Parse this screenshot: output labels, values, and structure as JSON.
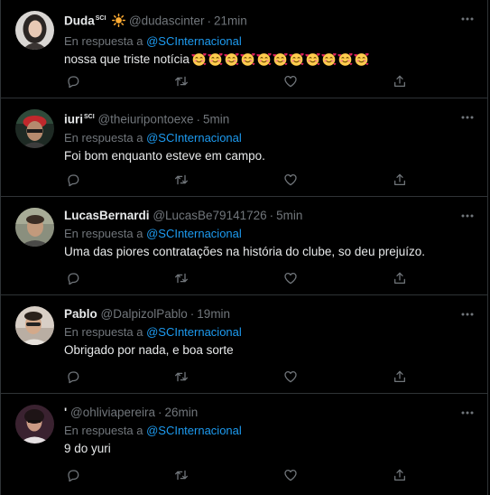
{
  "colors": {
    "background": "#000000",
    "text": "#e7e9ea",
    "muted": "#71767b",
    "link": "#1d9bf0",
    "divider": "#2f3336"
  },
  "reply_prefix": "En respuesta a",
  "tweets": [
    {
      "name": "Duda",
      "name_suffix": "SCI",
      "name_icon": "sun-icon",
      "handle": "@dudascinter",
      "dot": "·",
      "time": "21min",
      "mention": "@SCInternacional",
      "text": "nossa que triste notícia",
      "trailing_emoji": "smiling-face-with-hearts-icon",
      "trailing_emoji_count": 11
    },
    {
      "name": "iuri",
      "name_suffix": "SCI",
      "handle": "@theiuripontoexe",
      "dot": "·",
      "time": "5min",
      "mention": "@SCInternacional",
      "text": "Foi bom enquanto esteve em campo."
    },
    {
      "name": "LucasBernardi",
      "handle": "@LucasBe79141726",
      "dot": "·",
      "time": "5min",
      "mention": "@SCInternacional",
      "text": "Uma das piores contratações na história do clube, so deu prejuízo."
    },
    {
      "name": "Pablo",
      "handle": "@DalpizolPablo",
      "dot": "·",
      "time": "19min",
      "mention": "@SCInternacional",
      "text": "Obrigado por nada, e boa sorte"
    },
    {
      "name": "'",
      "handle": "@ohliviapereira",
      "dot": "·",
      "time": "26min",
      "mention": "@SCInternacional",
      "text": "9 do yuri"
    }
  ],
  "actions": [
    "reply-icon",
    "retweet-icon",
    "like-icon",
    "share-icon"
  ]
}
